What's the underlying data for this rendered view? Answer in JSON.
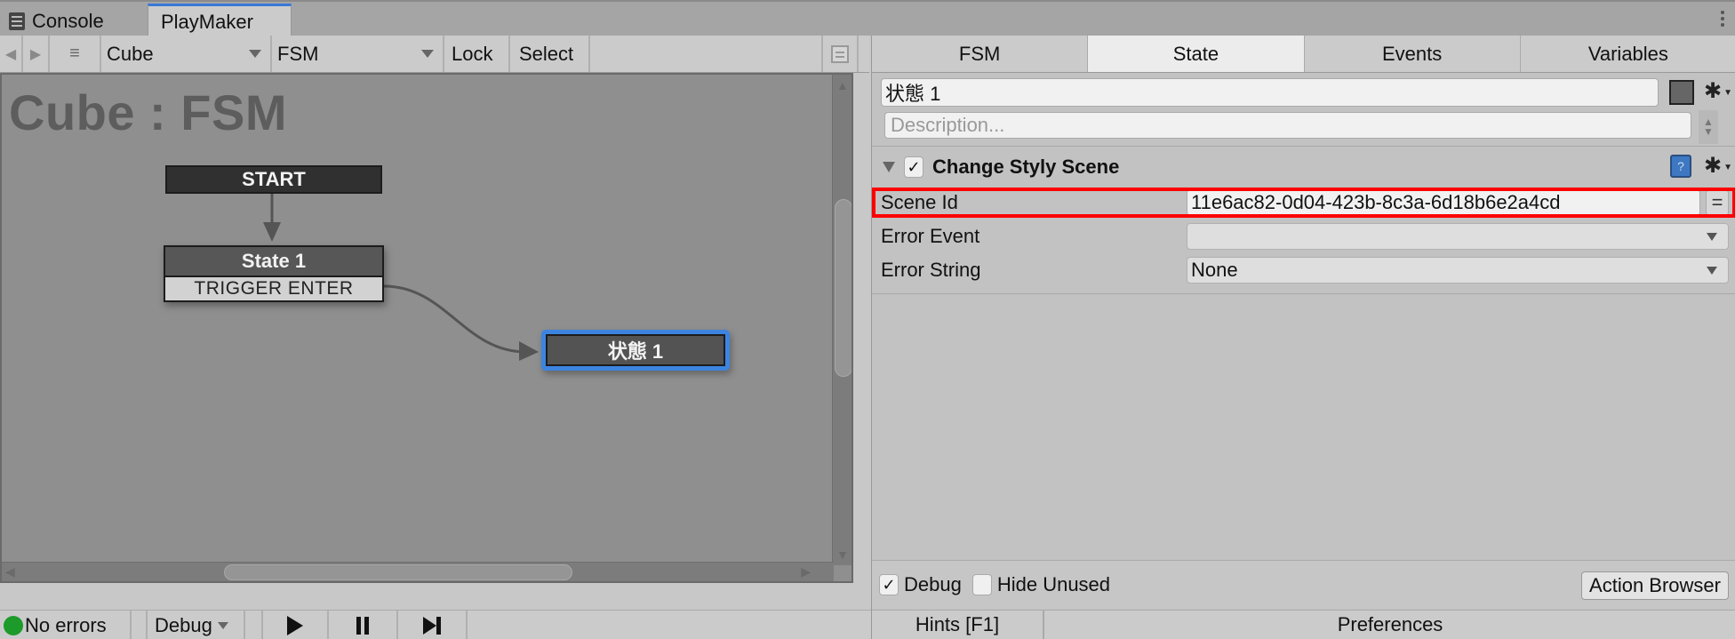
{
  "window_tabs": [
    {
      "label": "Console",
      "icon": "console-icon",
      "active": false
    },
    {
      "label": "PlayMaker",
      "active": true
    }
  ],
  "toolbar": {
    "back_icon": "◀",
    "forward_icon": "▶",
    "menu_icon": "≡",
    "gameobject_select": "Cube",
    "fsm_select": "FSM",
    "lock_label": "Lock",
    "select_label": "Select"
  },
  "canvas": {
    "title": "Cube : FSM",
    "nodes": {
      "start": "START",
      "state1": {
        "name": "State 1",
        "transition": "TRIGGER ENTER"
      },
      "selected": "状態 1"
    },
    "colors": {
      "selection": "#3d84e0"
    }
  },
  "status_bar": {
    "errors_label": "No errors",
    "errors_color": "#1c9a2a",
    "debug_label": "Debug"
  },
  "inspector": {
    "tabs": [
      {
        "label": "FSM",
        "active": false
      },
      {
        "label": "State",
        "active": true
      },
      {
        "label": "Events",
        "active": false
      },
      {
        "label": "Variables",
        "active": false
      }
    ],
    "state_name": "状態 1",
    "description_placeholder": "Description...",
    "action": {
      "enabled": true,
      "title": "Change Styly Scene",
      "properties": [
        {
          "label": "Scene Id",
          "value": "11e6ac82-0d04-423b-8c3a-6d18b6e2a4cd",
          "type": "text",
          "highlighted": true
        },
        {
          "label": "Error Event",
          "value": "",
          "type": "select"
        },
        {
          "label": "Error String",
          "value": "None",
          "type": "select"
        }
      ]
    },
    "debug_label": "Debug",
    "debug_checked": true,
    "hide_unused_label": "Hide Unused",
    "hide_unused_checked": false,
    "action_browser_label": "Action Browser",
    "footer": {
      "hints": "Hints [F1]",
      "preferences": "Preferences"
    },
    "highlight_color": "#ff0000"
  }
}
